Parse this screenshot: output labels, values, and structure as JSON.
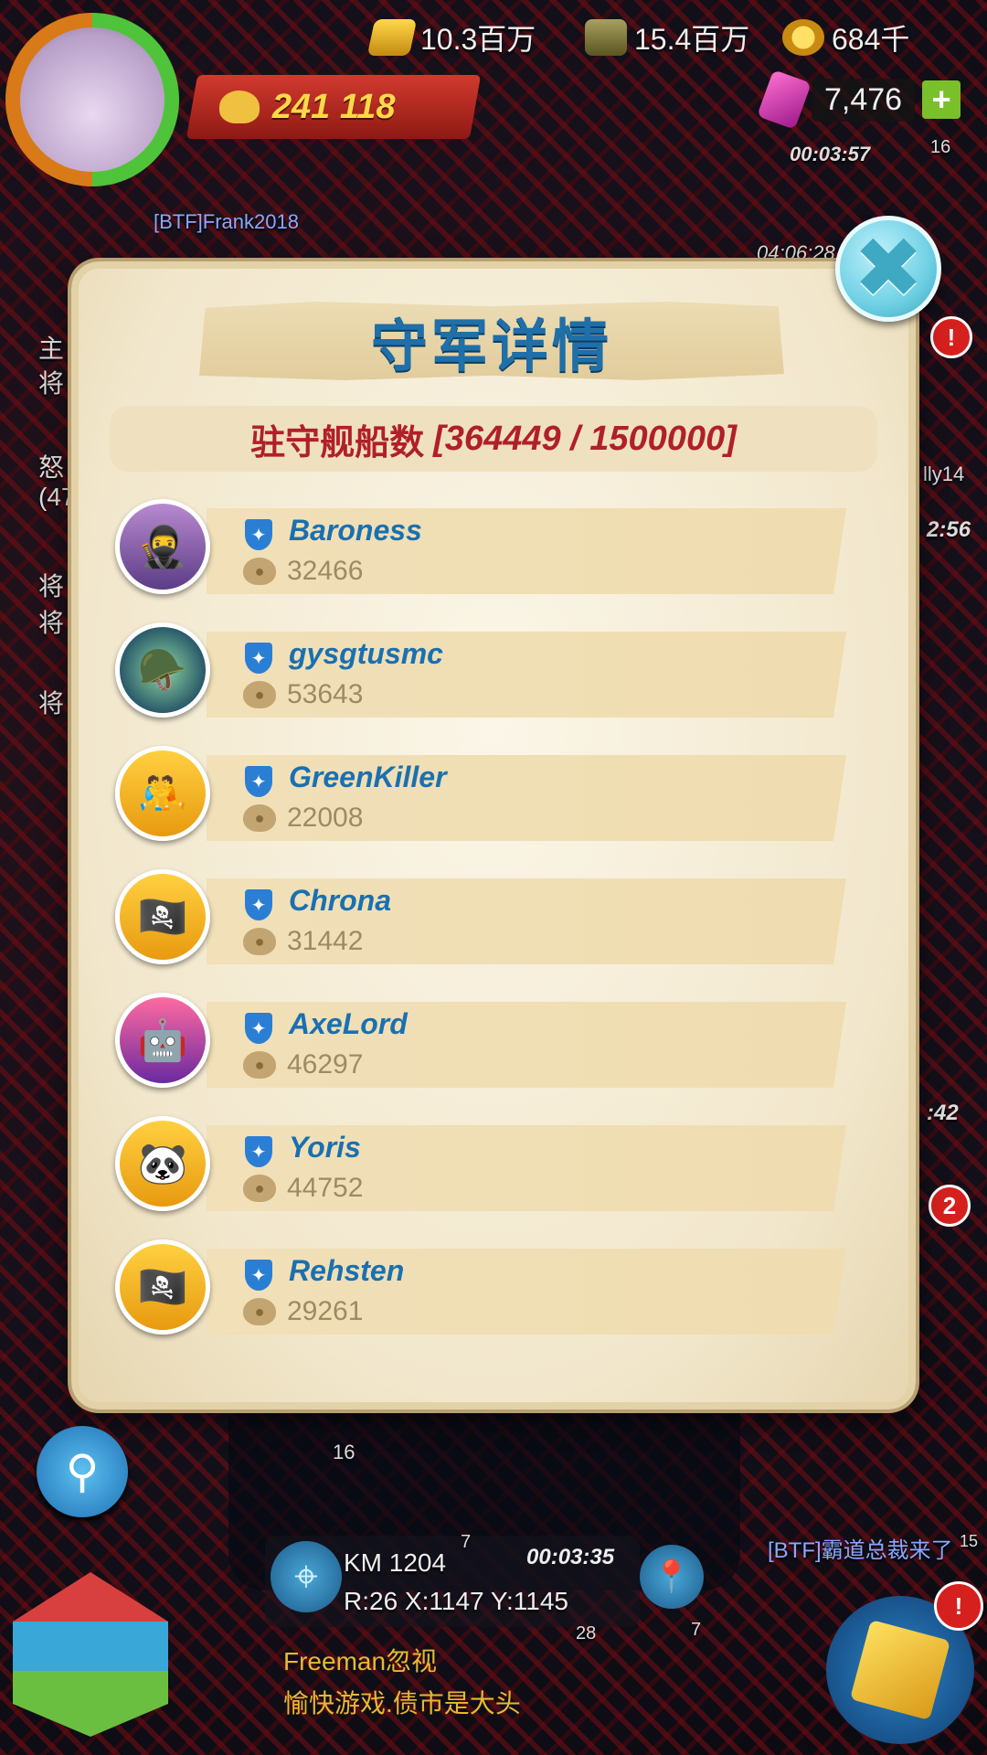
{
  "top_bar": {
    "gold": "10.3百万",
    "oil": "15.4百万",
    "coins": "684千",
    "gems": "7,476",
    "power": "241 118"
  },
  "map_labels": {
    "timer_top": "00:03:57",
    "timer_mid": "04:06:28",
    "player_tag": "[BTF]Frank2018",
    "level_tag": "16",
    "side_lines": [
      "主",
      "将",
      "怒",
      "(47",
      "将",
      "将",
      "将"
    ],
    "right_timer_1": "2:56",
    "right_timer_2": ":42",
    "right_name": "lly14",
    "alert_count_right": "2",
    "alliance_news": "[BTF]霸道总裁来了",
    "news_level": "15"
  },
  "modal": {
    "title": "守军详情",
    "garrison_label": "驻守舰船数",
    "garrison_value": "[364449 / 1500000]",
    "rows": [
      {
        "name": "Baroness",
        "ships": "32466",
        "avatar": "🥷"
      },
      {
        "name": "gysgtusmc",
        "ships": "53643",
        "avatar": "🪖"
      },
      {
        "name": "GreenKiller",
        "ships": "22008",
        "avatar": "🤼"
      },
      {
        "name": "Chrona",
        "ships": "31442",
        "avatar": "🏴‍☠️"
      },
      {
        "name": "AxeLord",
        "ships": "46297",
        "avatar": "🤖"
      },
      {
        "name": "Yoris",
        "ships": "44752",
        "avatar": "🐼"
      },
      {
        "name": "Rehsten",
        "ships": "29261",
        "avatar": "🏴‍☠️"
      }
    ]
  },
  "bottom": {
    "coord_line1": "KM 1204",
    "coord_line2": "R:26 X:1147 Y:1145",
    "timer": "00:03:35",
    "level_16": "16",
    "level_7a": "7",
    "level_28": "28",
    "level_7b": "7",
    "chat_line1": "Freeman忽视",
    "chat_line2": "愉快游戏.债市是大头"
  },
  "colors": {
    "title_blue": "#1f6fa8",
    "count_red": "#b0202a",
    "name_blue": "#1a70b0",
    "panel_bg": "#f2e7cc"
  },
  "icons": [
    "gold-icon",
    "oil-icon",
    "coin-icon",
    "gem-icon",
    "plus-icon",
    "shield-icon",
    "bag-icon",
    "close-icon",
    "search-icon",
    "target-icon",
    "map-pin-icon"
  ]
}
